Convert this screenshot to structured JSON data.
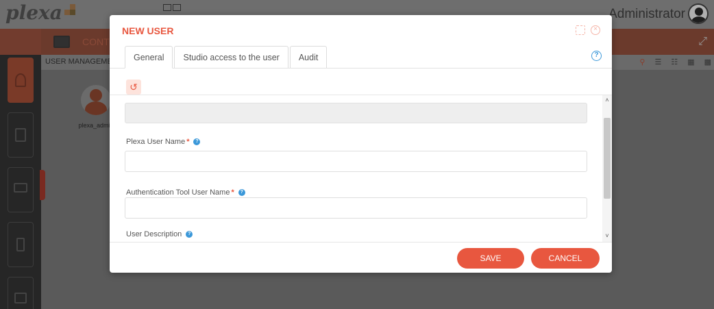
{
  "app": {
    "logo": "plexa",
    "user_name": "Administrator",
    "menu_label": "CONT",
    "section_title": "USER MANAGEME",
    "user_card_name": "plexa_admin"
  },
  "modal": {
    "title": "NEW USER",
    "tabs": [
      {
        "label": "General",
        "active": true
      },
      {
        "label": "Studio access to the user",
        "active": false
      },
      {
        "label": "Audit",
        "active": false
      }
    ],
    "fields": {
      "readonly_value": "",
      "plexa_user_name": {
        "label": "Plexa User Name",
        "value": ""
      },
      "auth_tool_user_name": {
        "label": "Authentication Tool User Name",
        "value": ""
      },
      "user_description": {
        "label": "User Description"
      }
    },
    "buttons": {
      "save": "SAVE",
      "cancel": "CANCEL"
    }
  },
  "colors": {
    "accent": "#e8573f",
    "help": "#3b98d9"
  },
  "icons": [
    "maximize-icon",
    "close-icon",
    "help-icon",
    "reset-icon",
    "question-icon"
  ]
}
